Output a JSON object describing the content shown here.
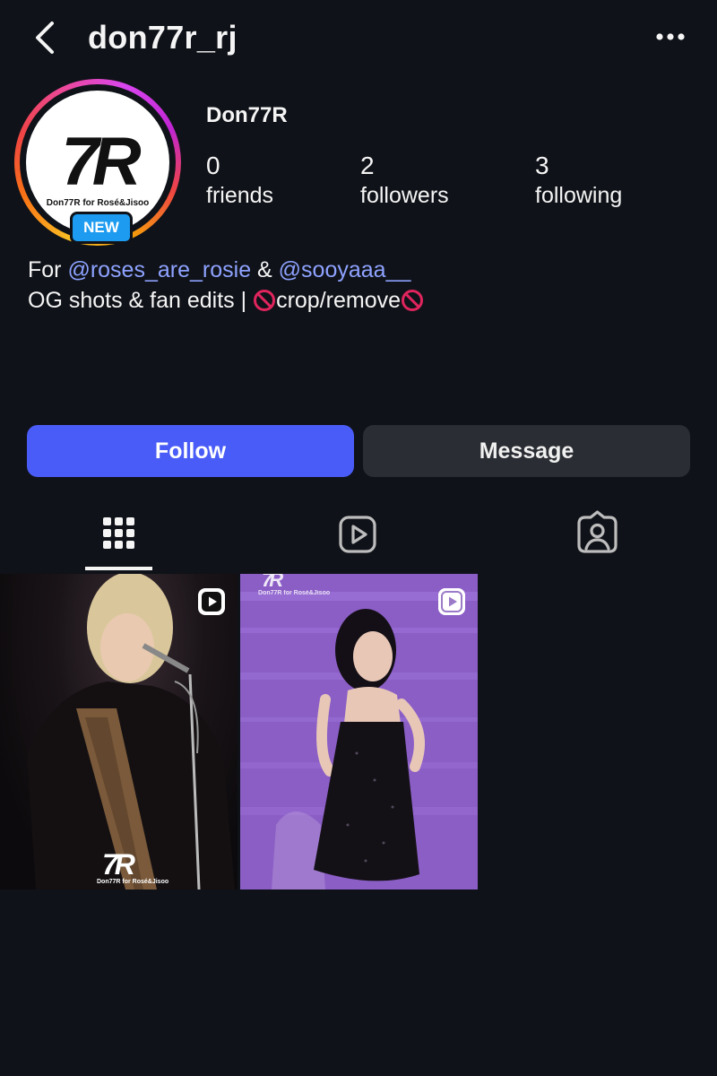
{
  "header": {
    "username": "don77r_rj"
  },
  "profile": {
    "display_name": "Don77R",
    "avatar": {
      "logo_text": "7R",
      "logo_subtext": "Don77R for Rosé&Jisoo",
      "badge": "NEW"
    },
    "stats": [
      {
        "count": "0",
        "label": "friends"
      },
      {
        "count": "2",
        "label": "followers"
      },
      {
        "count": "3",
        "label": "following"
      }
    ],
    "bio": {
      "line1_prefix": "For ",
      "mention1": "@roses_are_rosie",
      "line1_mid": " & ",
      "mention2": "@sooyaaa__",
      "line2_text": "OG shots & fan edits | ",
      "line2_inner": "crop/remove"
    }
  },
  "actions": {
    "follow_label": "Follow",
    "message_label": "Message"
  },
  "tabs": [
    {
      "icon": "grid-icon",
      "active": true
    },
    {
      "icon": "reels-icon",
      "active": false
    },
    {
      "icon": "tagged-icon",
      "active": false
    }
  ],
  "posts": [
    {
      "type": "reel",
      "watermark": "7R",
      "watermark_sub": "Don77R for Rosé&Jisoo"
    },
    {
      "type": "reel",
      "watermark": "7R",
      "watermark_sub": "Don77R for Rosé&Jisoo"
    }
  ],
  "colors": {
    "background": "#0f1218",
    "follow_button": "#4a5cf7",
    "message_button": "#2a2d33",
    "mention": "#8ea2ff",
    "new_badge": "#1d9bf0"
  }
}
